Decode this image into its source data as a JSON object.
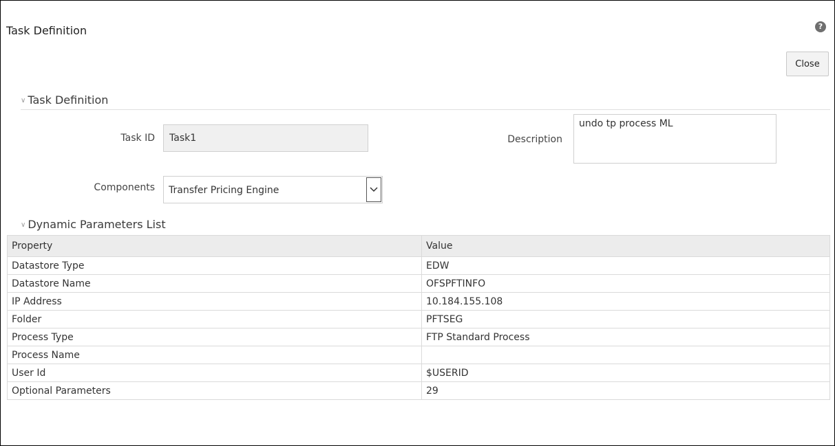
{
  "window": {
    "title": "Task Definition"
  },
  "toolbar": {
    "help_icon": "?",
    "close_label": "Close"
  },
  "task_section": {
    "header": "Task Definition",
    "task_id_label": "Task ID",
    "task_id_value": "Task1",
    "description_label": "Description",
    "description_value": "undo tp process ML",
    "components_label": "Components",
    "components_value": "Transfer Pricing Engine"
  },
  "params_section": {
    "header": "Dynamic Parameters List",
    "columns": {
      "property": "Property",
      "value": "Value"
    },
    "rows": [
      {
        "property": "Datastore Type",
        "value": "EDW"
      },
      {
        "property": "Datastore Name",
        "value": "OFSPFTINFO"
      },
      {
        "property": "IP Address",
        "value": "10.184.155.108"
      },
      {
        "property": "Folder",
        "value": "PFTSEG"
      },
      {
        "property": "Process Type",
        "value": "FTP Standard Process"
      },
      {
        "property": "Process Name",
        "value": ""
      },
      {
        "property": "User Id",
        "value": "$USERID"
      },
      {
        "property": "Optional Parameters",
        "value": "29"
      }
    ]
  }
}
